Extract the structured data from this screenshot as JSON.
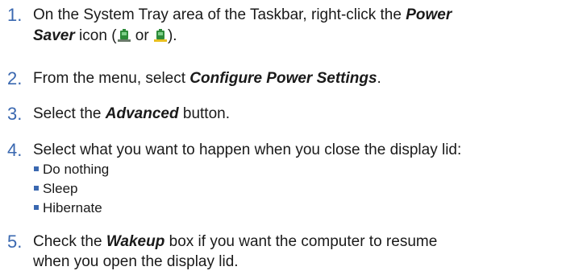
{
  "steps": [
    {
      "number": "1.",
      "line1_a": "On the System Tray area of the Taskbar, right-click the ",
      "line1_b": "Power",
      "line2_a": "Saver",
      "line2_b": " icon (",
      "line2_c": " or ",
      "line2_d": ").",
      "icon_1": "power-saver-ac-icon",
      "icon_2": "power-saver-battery-icon"
    },
    {
      "number": "2.",
      "text_a": "From the menu, select ",
      "text_b": "Configure Power Settings",
      "text_c": "."
    },
    {
      "number": "3.",
      "text_a": "Select the ",
      "text_b": "Advanced",
      "text_c": " button."
    },
    {
      "number": "4.",
      "text": "Select what you want to happen when you close the display lid:",
      "options": [
        "Do nothing",
        "Sleep",
        "Hibernate"
      ]
    },
    {
      "number": "5.",
      "line1_a": "Check the ",
      "line1_b": "Wakeup",
      "line1_c": " box if you want the computer to resume",
      "line2": "when you open the display lid."
    }
  ],
  "colors": {
    "accent": "#3a68b0",
    "icon_green": "#2e8b3a",
    "icon_yellow": "#e8c020"
  }
}
